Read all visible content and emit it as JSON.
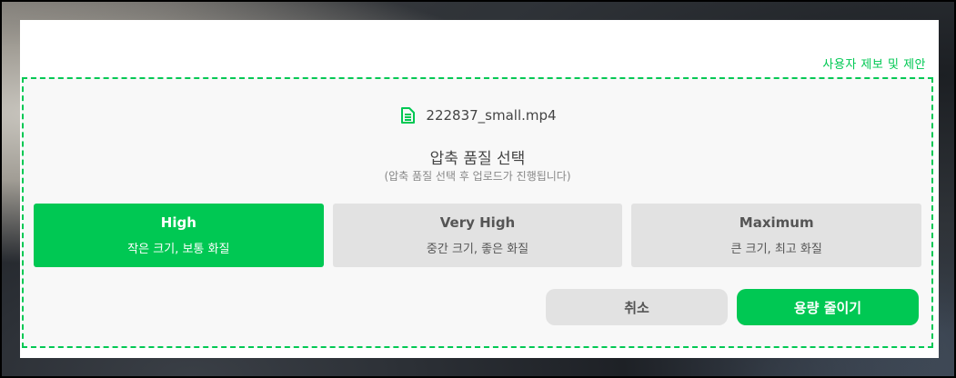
{
  "report_link": "사용자 제보 및 제안",
  "file": {
    "name": "222837_small.mp4",
    "icon": "document-icon"
  },
  "dialog": {
    "title": "압축 품질 선택",
    "subtitle": "(압축 품질 선택 후 업로드가 진행됩니다)"
  },
  "options": [
    {
      "name": "High",
      "desc": "작은 크기, 보통 화질",
      "selected": true
    },
    {
      "name": "Very High",
      "desc": "중간 크기, 좋은 화질",
      "selected": false
    },
    {
      "name": "Maximum",
      "desc": "큰 크기, 최고 화질",
      "selected": false
    }
  ],
  "buttons": {
    "cancel": "취소",
    "reduce": "용량 줄이기"
  },
  "colors": {
    "accent": "#00c853",
    "inactive": "#e2e2e2"
  }
}
